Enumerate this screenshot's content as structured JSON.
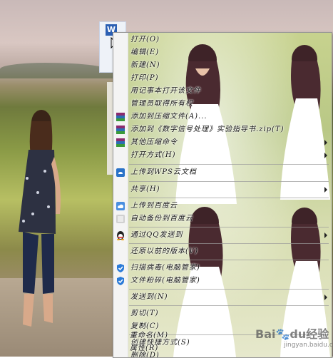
{
  "menu": {
    "items": [
      {
        "label": "打开(O)",
        "top": 0
      },
      {
        "label": "编辑(E)"
      },
      {
        "label": "新建(N)"
      },
      {
        "label": "打印(P)"
      },
      {
        "label": "用记事本打开该文件"
      },
      {
        "label": "管理员取得所有权"
      },
      {
        "label": "添加到压缩文件(A)..."
      },
      {
        "label": "添加到《数字信号处理》实验指导书.zip(T)"
      },
      {
        "label": "其他压缩命令"
      },
      {
        "label": "打开方式(H)"
      },
      {
        "label": "上传到WPS云文档"
      },
      {
        "label": "共享(H)"
      },
      {
        "label": "上传到百度云"
      },
      {
        "label": "自动备份到百度云"
      },
      {
        "label": "通过QQ发送到"
      },
      {
        "label": "还原以前的版本(V)"
      },
      {
        "label": "扫描病毒(电脑管家)"
      },
      {
        "label": "文件粉碎(电脑管家)"
      },
      {
        "label": "发送到(N)"
      },
      {
        "label": "剪切(T)"
      },
      {
        "label": "复制(C)"
      },
      {
        "label": "创建快捷方式(S)"
      },
      {
        "label": "删除(D)"
      },
      {
        "label": "重命名(M)"
      },
      {
        "label": "属性(R)"
      }
    ]
  },
  "desktop": {
    "file_icon_letter": "W"
  },
  "watermark": {
    "brand": "Bai",
    "paw": "du",
    "suffix": "经验",
    "site": "jingyan.baidu.com"
  },
  "colors": {
    "menu_bg": "#f0f0f0",
    "menu_border": "#979797",
    "separator": "#9a9a9a"
  }
}
